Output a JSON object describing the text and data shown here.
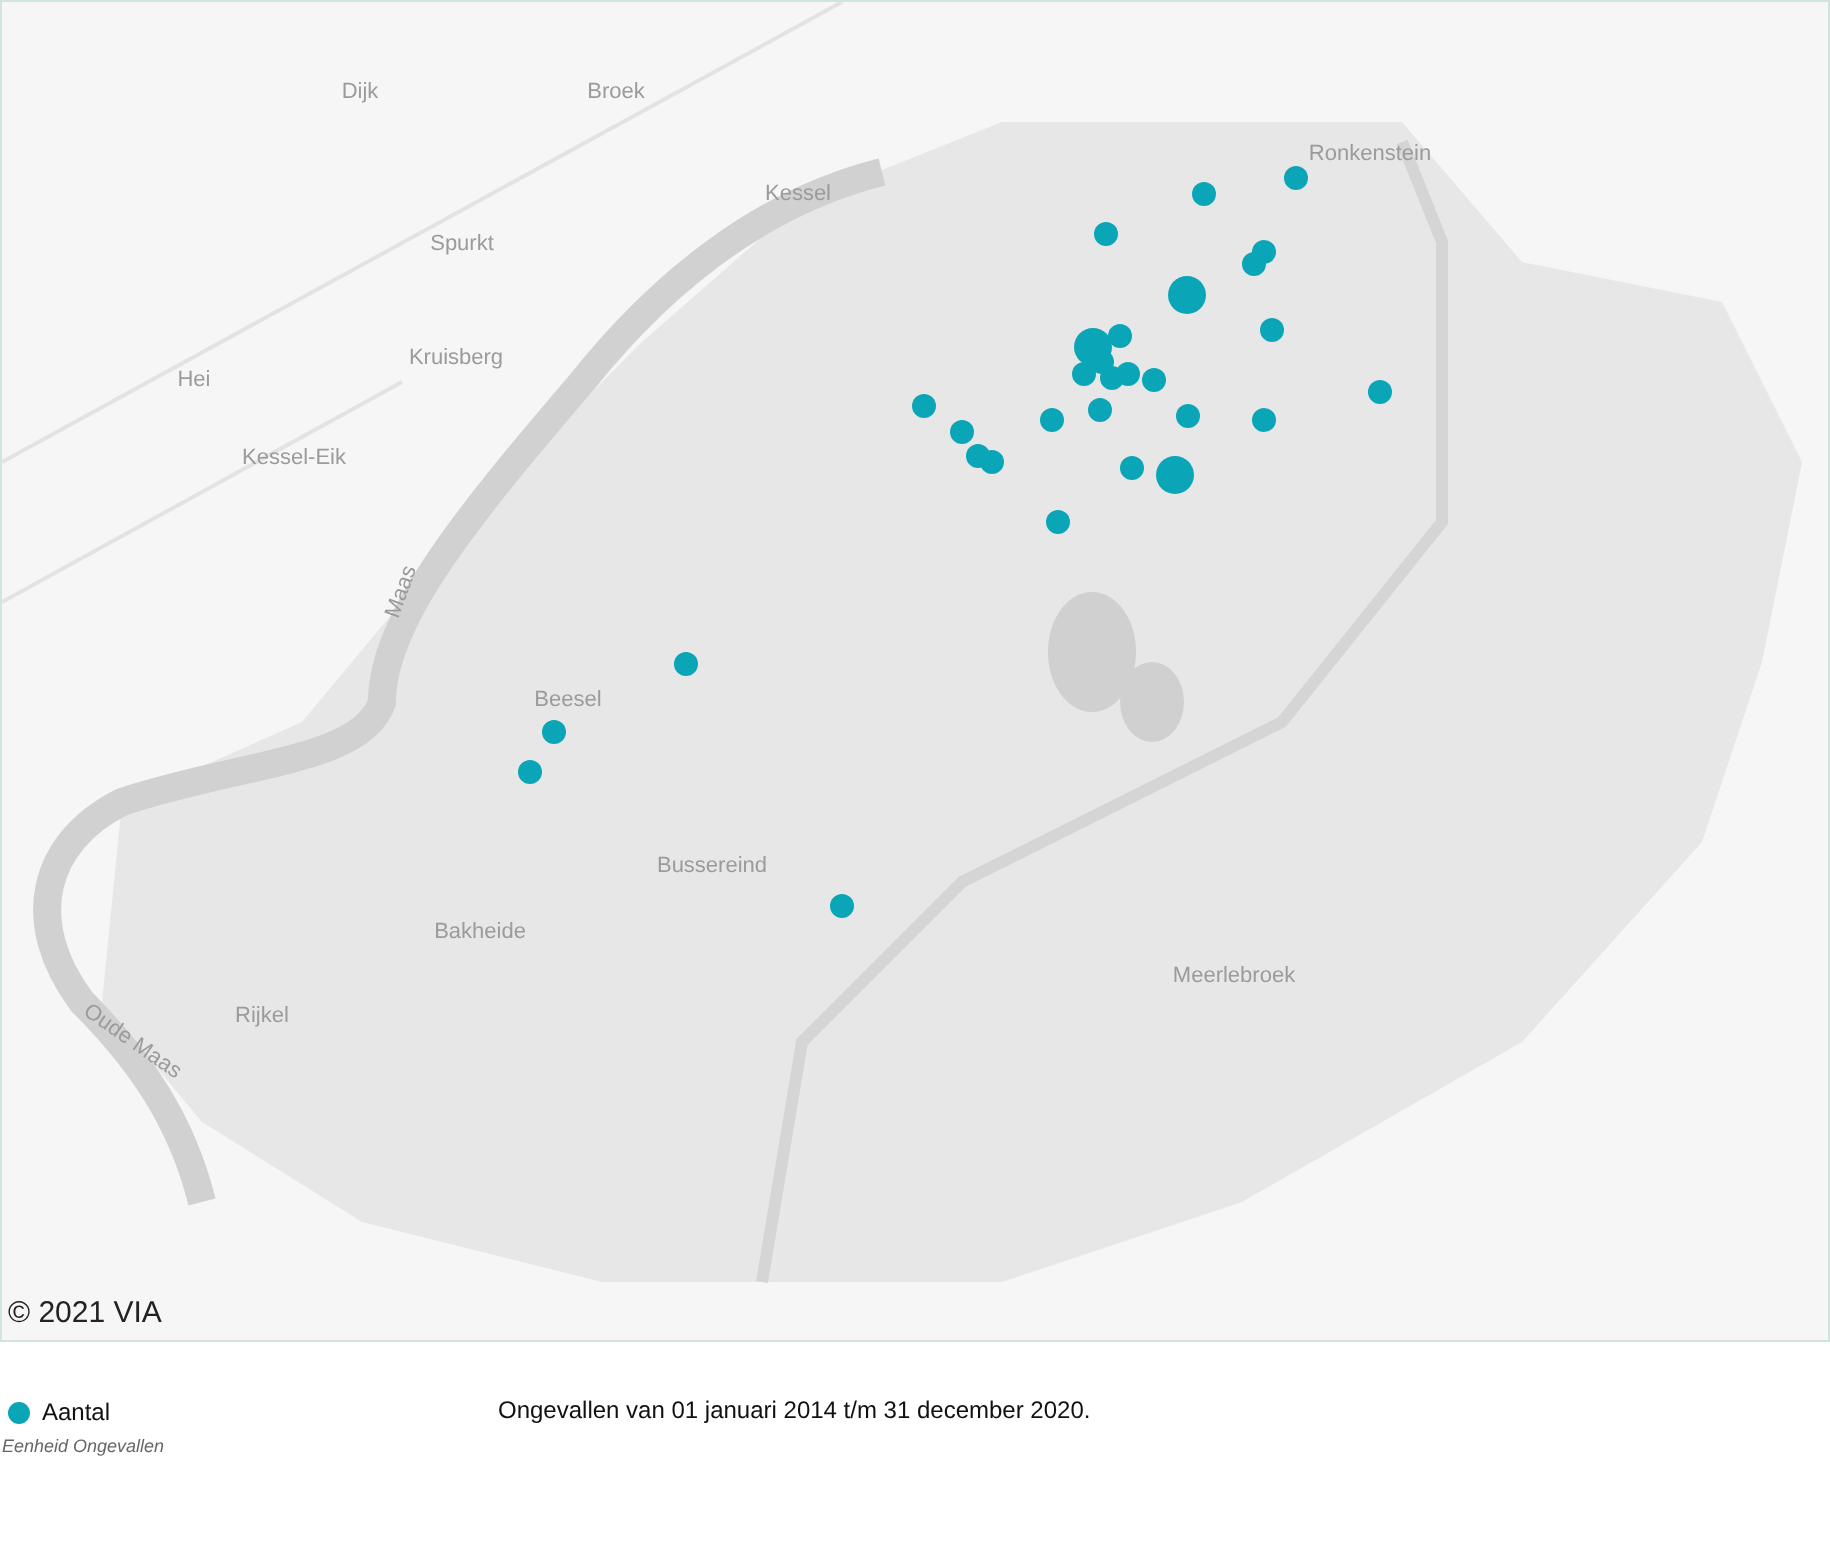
{
  "map": {
    "places": [
      "Dijk",
      "Broek",
      "Kessel",
      "Spurkt",
      "Kruisberg",
      "Hei",
      "Kessel-Eik",
      "Maas",
      "Ronkenstein",
      "Beesel",
      "Bussereind",
      "Bakheide",
      "Rijkel",
      "Oude Maas",
      "Meerlebroek"
    ],
    "markers": [
      {
        "kind": "small"
      },
      {
        "kind": "small"
      },
      {
        "kind": "small"
      },
      {
        "kind": "small"
      },
      {
        "kind": "small"
      },
      {
        "kind": "large"
      },
      {
        "kind": "small"
      },
      {
        "kind": "small"
      },
      {
        "kind": "large"
      },
      {
        "kind": "small"
      },
      {
        "kind": "small"
      },
      {
        "kind": "small"
      },
      {
        "kind": "small"
      },
      {
        "kind": "small"
      },
      {
        "kind": "small"
      },
      {
        "kind": "small"
      },
      {
        "kind": "small"
      },
      {
        "kind": "small"
      },
      {
        "kind": "small"
      },
      {
        "kind": "small"
      },
      {
        "kind": "small"
      },
      {
        "kind": "small"
      },
      {
        "kind": "small"
      },
      {
        "kind": "small"
      },
      {
        "kind": "large"
      },
      {
        "kind": "small"
      },
      {
        "kind": "small"
      },
      {
        "kind": "small"
      },
      {
        "kind": "small"
      },
      {
        "kind": "small"
      }
    ],
    "copyright": "© 2021 VIA"
  },
  "legend": {
    "label": "Aantal",
    "unit": "Eenheid Ongevallen"
  },
  "caption": "Ongevallen van 01 januari 2014 t/m 31 december 2020."
}
